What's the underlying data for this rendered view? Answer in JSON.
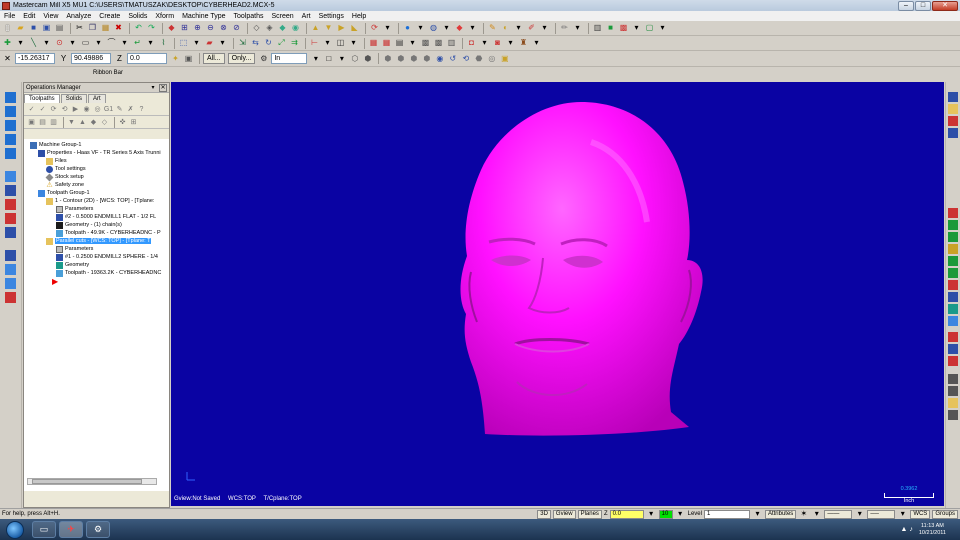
{
  "window": {
    "title": "Mastercam Mill X5 MU1  C:\\USERS\\TMATUSZAK\\DESKTOP\\CYBERHEAD2.MCX-5",
    "controls": {
      "minimize": "–",
      "maximize": "□",
      "close": "✕"
    }
  },
  "menu": [
    "File",
    "Edit",
    "View",
    "Analyze",
    "Create",
    "Solids",
    "Xform",
    "Machine Type",
    "Toolpaths",
    "Screen",
    "Art",
    "Settings",
    "Help"
  ],
  "ribbon": {
    "x_value": "-15.26317",
    "y_value": "90.49886",
    "z_value": "0.0",
    "all_button": "All...",
    "only_button": "Only...",
    "in_select": "In",
    "label": "Ribbon Bar"
  },
  "ops_manager": {
    "title": "Operations Manager",
    "tabs": [
      "Toolpaths",
      "Solids",
      "Art"
    ],
    "tree": [
      {
        "text": "Machine Group-1",
        "indent": 0,
        "icon": "machine-group-icon"
      },
      {
        "text": "Properties - Haas VF - TR Series 5 Axis Trunni",
        "indent": 1,
        "icon": "properties-icon"
      },
      {
        "text": "Files",
        "indent": 2,
        "icon": "folder-icon"
      },
      {
        "text": "Tool settings",
        "indent": 2,
        "icon": "tool-settings-icon"
      },
      {
        "text": "Stock setup",
        "indent": 2,
        "icon": "stock-setup-icon"
      },
      {
        "text": "Safety zone",
        "indent": 2,
        "icon": "safety-zone-icon"
      },
      {
        "text": "Toolpath Group-1",
        "indent": 1,
        "icon": "toolpath-group-icon"
      },
      {
        "text": "1 - Contour (2D) - [WCS: TOP] - [Tplane:",
        "indent": 2,
        "icon": "operation-folder-icon"
      },
      {
        "text": "Parameters",
        "indent": 3,
        "icon": "parameters-icon"
      },
      {
        "text": "#2 - 0.5000 ENDMILL1 FLAT - 1/2 FL",
        "indent": 3,
        "icon": "tool-icon"
      },
      {
        "text": "Geometry - (1) chain(s)",
        "indent": 3,
        "icon": "geometry-icon"
      },
      {
        "text": "Toolpath - 49.9K - CYBERHEADNC - P",
        "indent": 3,
        "icon": "toolpath-icon"
      },
      {
        "text": "Parallel cuts - [WCS: TOP] - [Tplane: T",
        "indent": 2,
        "icon": "operation-folder-icon",
        "selected": true
      },
      {
        "text": "Parameters",
        "indent": 3,
        "icon": "parameters-icon"
      },
      {
        "text": "#1 - 0.2500 ENDMILL2 SPHERE - 1/4",
        "indent": 3,
        "icon": "tool-icon"
      },
      {
        "text": "Geometry",
        "indent": 3,
        "icon": "geometry-icon"
      },
      {
        "text": "Toolpath - 19363.2K - CYBERHEADNC",
        "indent": 3,
        "icon": "toolpath-icon"
      },
      {
        "text": "",
        "indent": 2,
        "icon": "insert-arrow-icon"
      }
    ]
  },
  "viewport": {
    "gview": "Gview:Not Saved",
    "wcs": "WCS:TOP",
    "tcplane": "T/Cplane:TOP",
    "scale_value": "0.3962",
    "scale_unit": "Inch",
    "background": "#0a03a3",
    "model_color": "#ff10ff"
  },
  "statusbar": {
    "help": "For help, press Alt+H.",
    "btn_3d": "3D",
    "btn_gview": "Gview",
    "btn_planes": "Planes",
    "z_label": "Z",
    "z_value": "0.0",
    "level_label": "Level",
    "level_value": "1",
    "color_value": "10",
    "attributes": "Attributes",
    "wcs": "WCS",
    "groups": "Groups"
  },
  "taskbar": {
    "time": "11:13 AM",
    "date": "10/21/2011"
  }
}
